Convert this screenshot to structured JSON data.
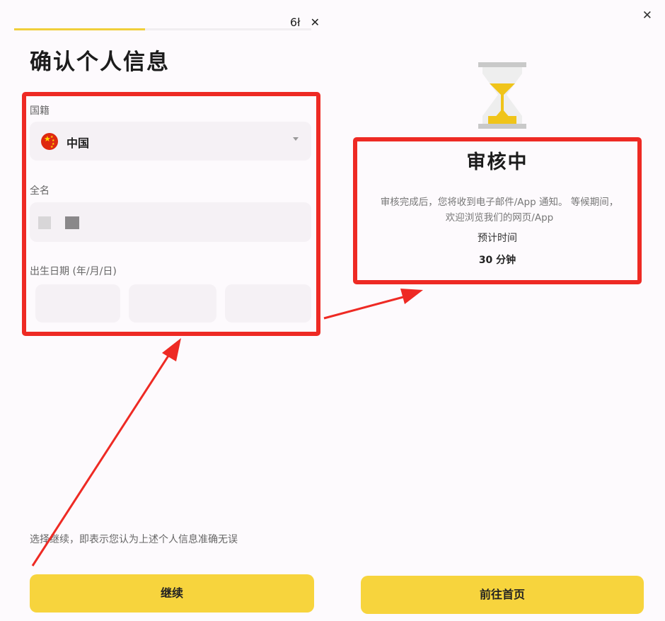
{
  "left": {
    "header": {
      "icon_text": "6ł",
      "close_text": "✕",
      "progress_fraction": 0.44
    },
    "title": "确认个人信息",
    "nationality": {
      "label": "国籍",
      "value": "中国"
    },
    "full_name": {
      "label": "全名"
    },
    "birth_date": {
      "label": "出生日期 (年/月/日)"
    },
    "notice": "选择继续，即表示您认为上述个人信息准确无误",
    "continue_button": "继续"
  },
  "right": {
    "close_text": "✕",
    "title": "审核中",
    "desc_line1": "审核完成后，您将收到电子邮件/App 通知。 等候期间，",
    "desc_line2": "欢迎浏览我们的网页/App",
    "estimate_label": "预计时间",
    "estimate_value": "30 分钟",
    "home_button": "前往首页"
  },
  "colors": {
    "accent_yellow": "#f7d43d",
    "annotation_red": "#ee2a24",
    "field_bg": "#f5f1f5"
  }
}
